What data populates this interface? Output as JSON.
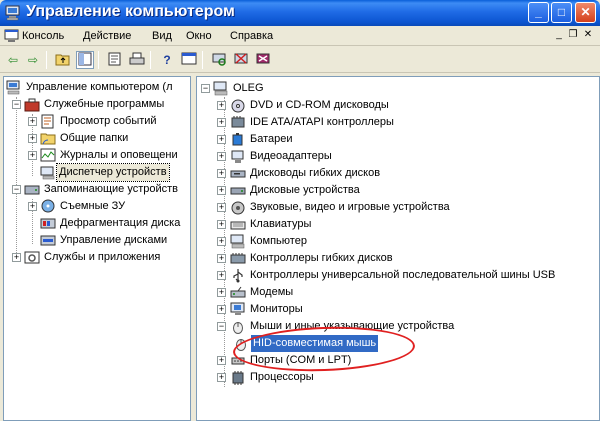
{
  "window": {
    "title": "Управление компьютером",
    "controls": {
      "minimize": "_",
      "maximize": "□",
      "close": "✕"
    }
  },
  "menu": {
    "items": [
      "Консоль",
      "Действие",
      "Вид",
      "Окно",
      "Справка"
    ],
    "mdi_controls": {
      "minimize": "_",
      "restore": "❐",
      "close": "✕"
    }
  },
  "toolbar": {
    "buttons": [
      "back-icon",
      "forward-icon",
      "up-folder-icon",
      "show-hide-tree-icon",
      "properties-icon",
      "print-icon",
      "help-icon",
      "console-icon",
      "scan-hardware-icon",
      "disable-device-icon",
      "uninstall-device-icon"
    ]
  },
  "left_tree": {
    "root": "Управление компьютером (л",
    "items": [
      {
        "label": "Служебные программы",
        "level": 1,
        "expanded": true
      },
      {
        "label": "Просмотр событий",
        "level": 2,
        "expanded": false
      },
      {
        "label": "Общие папки",
        "level": 2,
        "expanded": false
      },
      {
        "label": "Журналы и оповещени",
        "level": 2,
        "expanded": false
      },
      {
        "label": "Диспетчер устройств",
        "level": 2,
        "expanded": null,
        "selected": true
      },
      {
        "label": "Запоминающие устройств",
        "level": 1,
        "expanded": true
      },
      {
        "label": "Съемные ЗУ",
        "level": 2,
        "expanded": false
      },
      {
        "label": "Дефрагментация диска",
        "level": 2,
        "expanded": null
      },
      {
        "label": "Управление дисками",
        "level": 2,
        "expanded": null
      },
      {
        "label": "Службы и приложения",
        "level": 1,
        "expanded": false
      }
    ]
  },
  "right_tree": {
    "root": "OLEG",
    "items": [
      {
        "label": "DVD и CD-ROM дисководы",
        "icon": "dvd-drive-icon"
      },
      {
        "label": "IDE ATA/ATAPI контроллеры",
        "icon": "ide-controller-icon"
      },
      {
        "label": "Батареи",
        "icon": "battery-icon"
      },
      {
        "label": "Видеоадаптеры",
        "icon": "display-adapter-icon"
      },
      {
        "label": "Дисководы гибких дисков",
        "icon": "floppy-drive-icon"
      },
      {
        "label": "Дисковые устройства",
        "icon": "disk-drive-icon"
      },
      {
        "label": "Звуковые, видео и игровые устройства",
        "icon": "sound-device-icon"
      },
      {
        "label": "Клавиатуры",
        "icon": "keyboard-icon"
      },
      {
        "label": "Компьютер",
        "icon": "computer-icon"
      },
      {
        "label": "Контроллеры гибких дисков",
        "icon": "floppy-controller-icon"
      },
      {
        "label": "Контроллеры универсальной последовательной шины USB",
        "icon": "usb-icon"
      },
      {
        "label": "Модемы",
        "icon": "modem-icon"
      },
      {
        "label": "Мониторы",
        "icon": "monitor-icon"
      },
      {
        "label": "Мыши и иные указывающие устройства",
        "icon": "mouse-icon",
        "expanded": true
      },
      {
        "label": "HID-совместимая мышь",
        "icon": "mouse-icon",
        "child": true,
        "selected": true
      },
      {
        "label": "Порты (COM и LPT)",
        "icon": "port-icon"
      },
      {
        "label": "Процессоры",
        "icon": "processor-icon"
      }
    ]
  },
  "colors": {
    "titlebar": "#0a5fd8",
    "selection": "#316ac5",
    "annotation": "#e02020"
  }
}
